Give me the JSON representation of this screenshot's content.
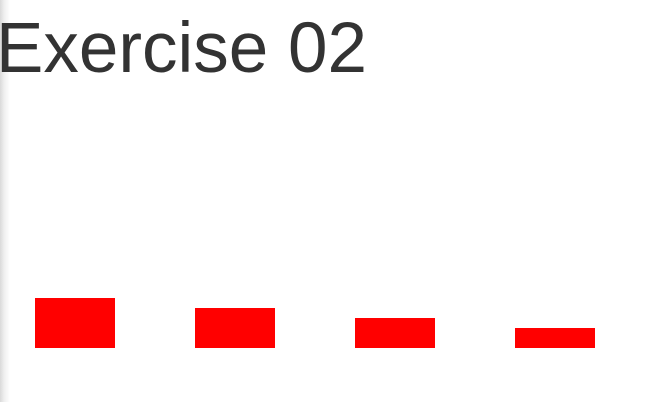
{
  "page": {
    "title": "Exercise 02"
  },
  "bars": {
    "color": "#ff0000",
    "values": [
      50,
      40,
      30,
      20
    ]
  }
}
